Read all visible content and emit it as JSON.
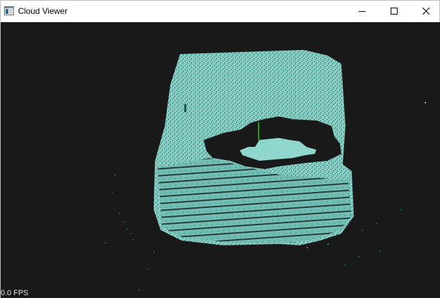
{
  "window": {
    "title": "Cloud Viewer",
    "app_icon": "window-app-icon",
    "controls": {
      "minimize_icon": "minimize-icon",
      "maximize_icon": "maximize-icon",
      "close_icon": "close-icon"
    }
  },
  "viewer": {
    "background_color": "#191919",
    "point_color": "#7fcfc4",
    "axis_color": "#1fd11f",
    "fps_label": "0.0 FPS"
  }
}
